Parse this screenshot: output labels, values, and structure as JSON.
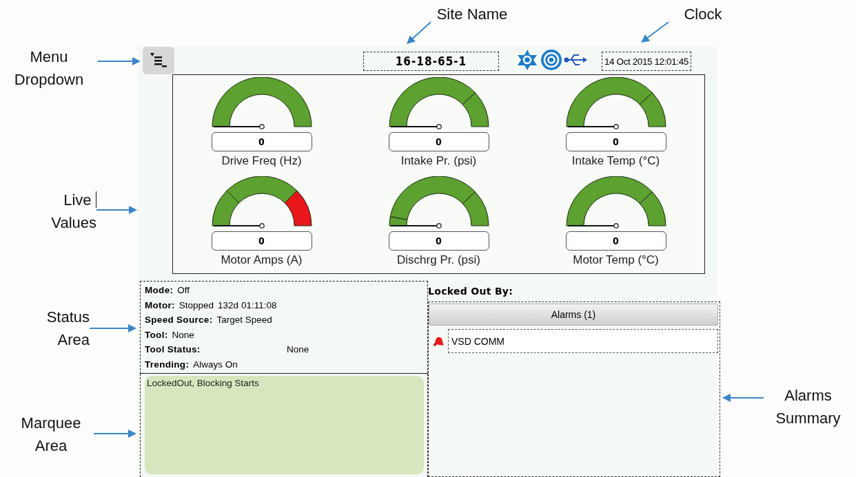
{
  "callouts": [
    {
      "lines": [
        "Site Name"
      ]
    },
    {
      "lines": [
        "Clock"
      ]
    },
    {
      "lines": [
        "Menu",
        "Dropdown"
      ]
    },
    {
      "lines": [
        "Live",
        "Values"
      ],
      "cursor": true
    },
    {
      "lines": [
        "Status",
        "Area"
      ]
    },
    {
      "lines": [
        "Marquee",
        "Area"
      ]
    },
    {
      "lines": [
        "Alarms",
        "Summary"
      ]
    }
  ],
  "top_bar": {
    "site_name": "16-18-65-1",
    "clock": "14 Oct 2015 12:01:45"
  },
  "gauges": [
    {
      "label": "Drive Freq (Hz)",
      "value": "0",
      "zones": [
        {
          "color": "#5da130"
        }
      ]
    },
    {
      "label": "Intake Pr. (psi)",
      "value": "0",
      "zones": [
        {
          "color": "#5da130"
        },
        {
          "color": "#5da130"
        }
      ]
    },
    {
      "label": "Intake Temp (°C)",
      "value": "0",
      "zones": [
        {
          "color": "#5da130"
        },
        {
          "color": "#5da130"
        }
      ]
    },
    {
      "label": "Motor Amps (A)",
      "value": "0",
      "zones": [
        {
          "color": "#5da130"
        },
        {
          "color": "#5da130"
        },
        {
          "color": "#e8161a"
        }
      ]
    },
    {
      "label": "Dischrg Pr. (psi)",
      "value": "0",
      "zones": [
        {
          "color": "#5da130"
        },
        {
          "color": "#5da130"
        },
        {
          "color": "#5da130"
        }
      ]
    },
    {
      "label": "Motor Temp (°C)",
      "value": "0",
      "zones": [
        {
          "color": "#5da130"
        },
        {
          "color": "#5da130"
        }
      ]
    }
  ],
  "status": [
    {
      "kind": "inline",
      "label": "Mode:",
      "value": "Off"
    },
    {
      "kind": "inline",
      "label": "Motor:",
      "value": "Stopped",
      "extra": "132d 01:11:08"
    },
    {
      "kind": "inline",
      "label": "Speed Source:",
      "value": "Target Speed"
    },
    {
      "kind": "inline",
      "label": "Tool:",
      "value": "None"
    },
    {
      "kind": "tabbed",
      "label": "Tool Status:",
      "value": "None"
    },
    {
      "kind": "inline",
      "label": "Trending:",
      "value": "Always On"
    }
  ],
  "marquee": "LockedOut, Blocking Starts",
  "locked_out_by": "Locked Out By:",
  "alarms": {
    "header": "Alarms (1)",
    "rows": [
      {
        "text": "VSD COMM"
      }
    ]
  }
}
